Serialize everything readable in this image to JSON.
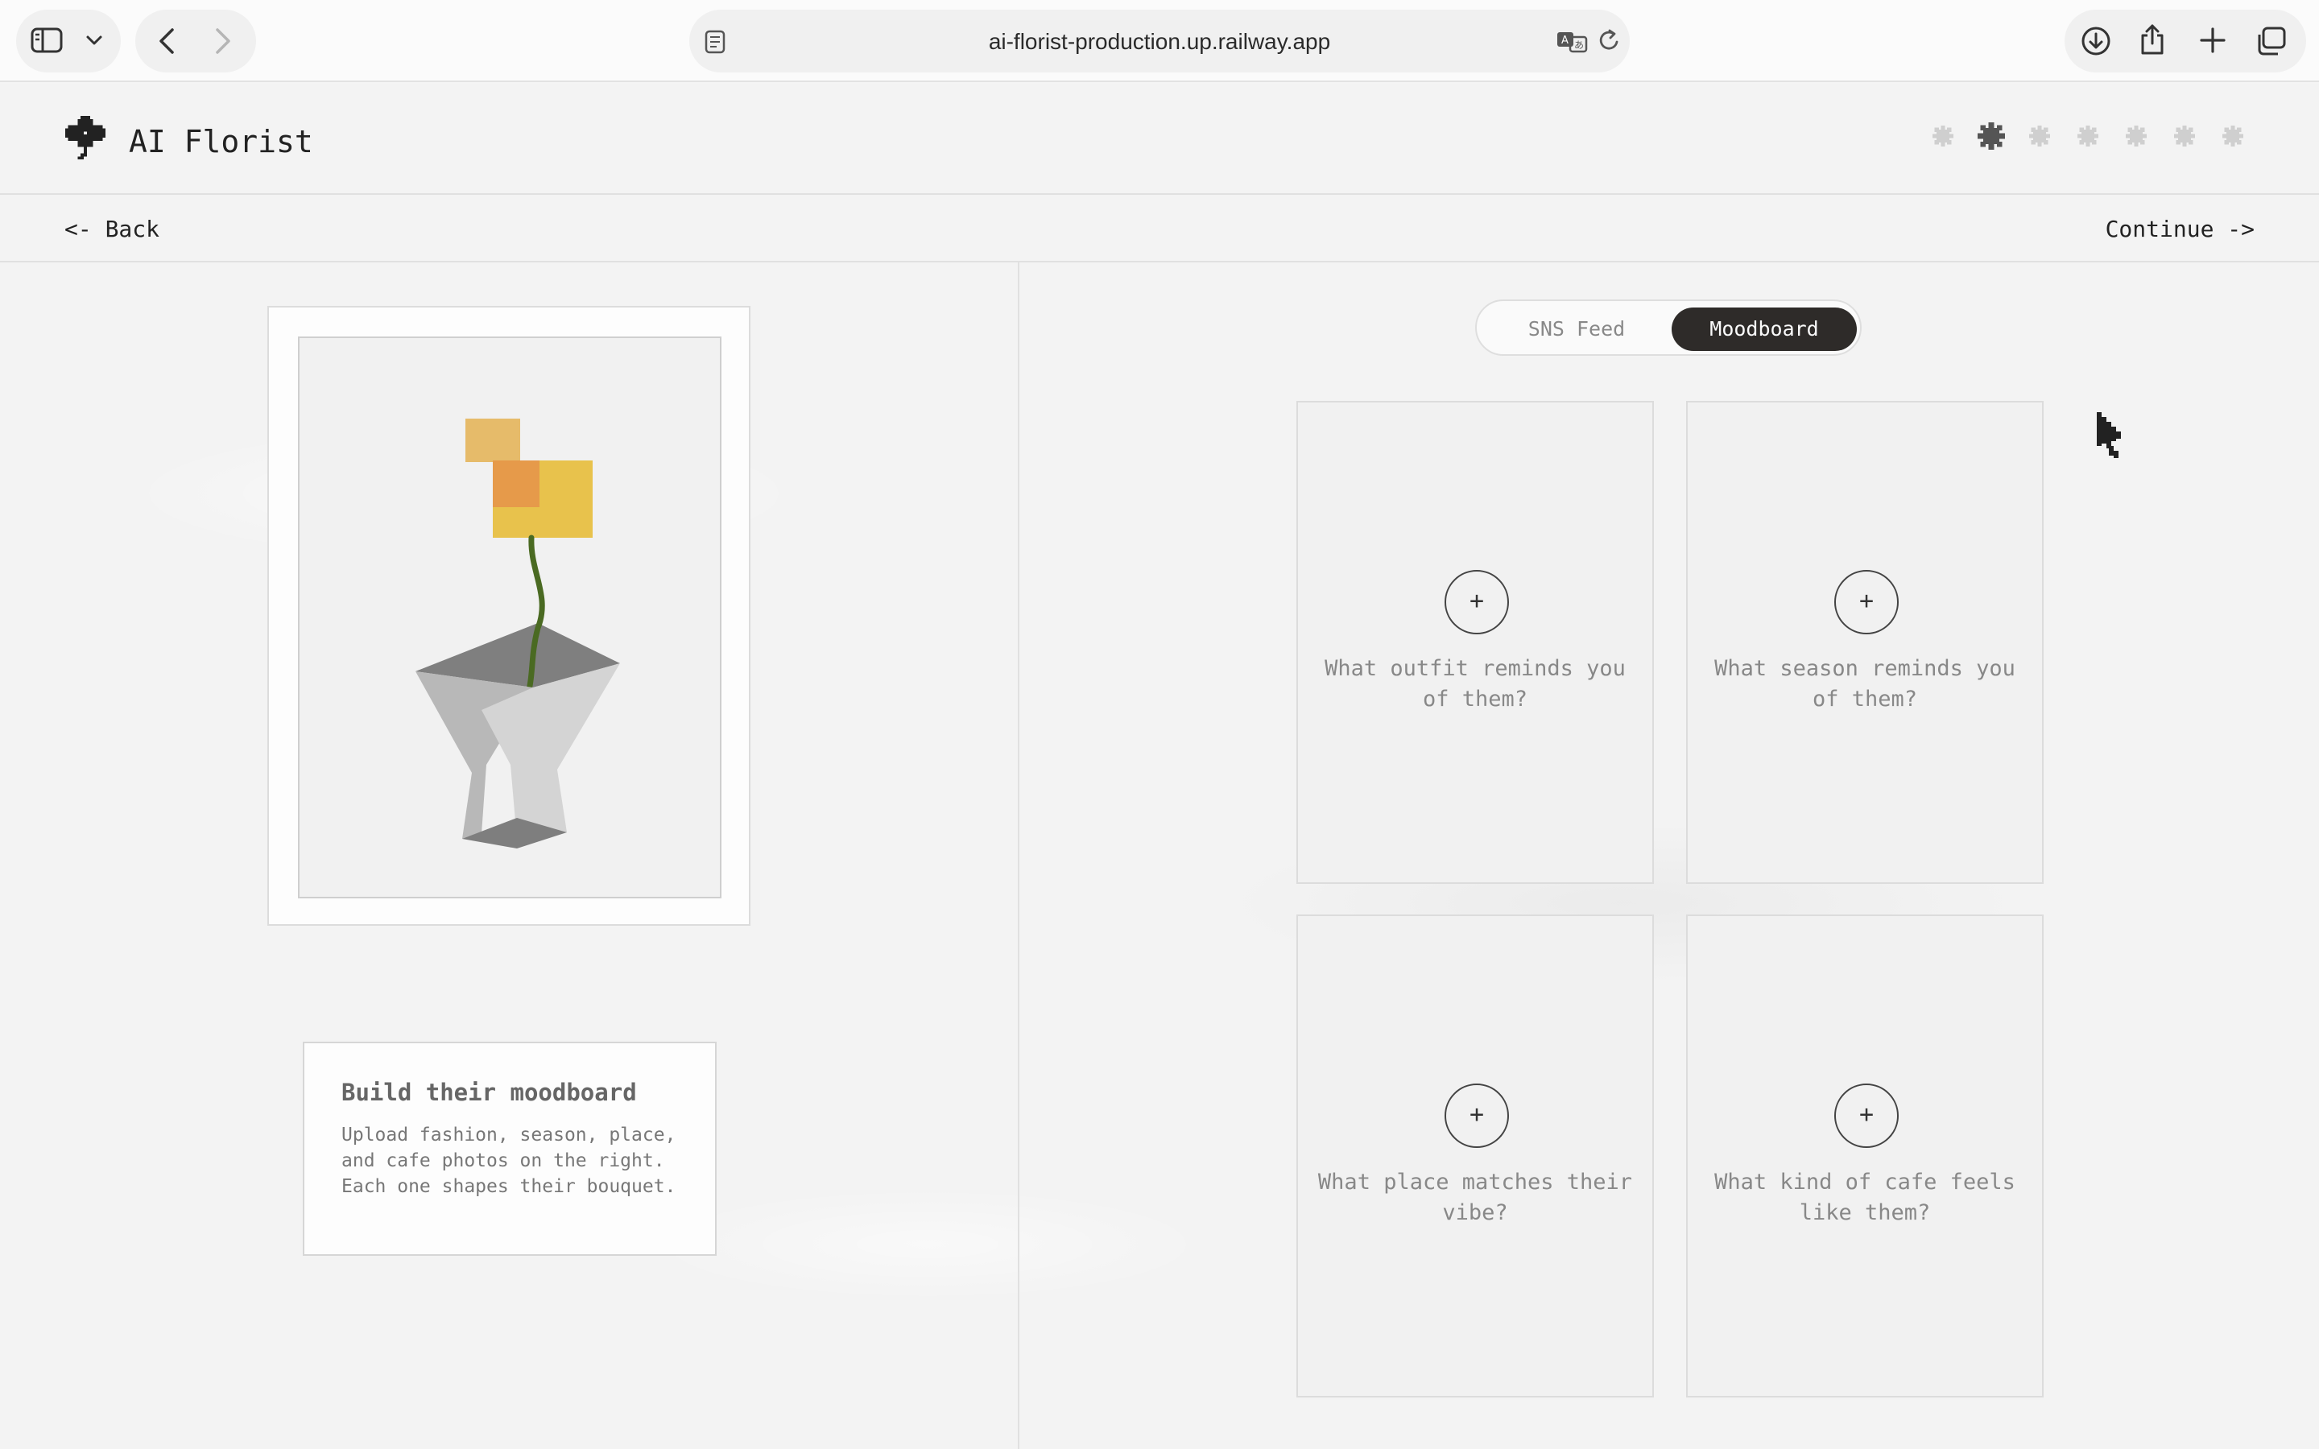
{
  "browser": {
    "url": "ai-florist-production.up.railway.app"
  },
  "app": {
    "title": "AI Florist",
    "progress": {
      "total_steps": 7,
      "current_step": 2
    }
  },
  "nav": {
    "back_label": "<- Back",
    "continue_label": "Continue ->"
  },
  "info": {
    "title": "Build their moodboard",
    "body": "Upload fashion, season, place, and cafe photos on the right. Each one shapes their bouquet."
  },
  "toggle": {
    "options": [
      "SNS Feed",
      "Moodboard"
    ],
    "selected": "Moodboard"
  },
  "tiles": [
    {
      "plus": "+",
      "prompt": "What outfit reminds you of them?"
    },
    {
      "plus": "+",
      "prompt": "What season reminds you of them?"
    },
    {
      "plus": "+",
      "prompt": "What place matches their vibe?"
    },
    {
      "plus": "+",
      "prompt": "What kind of cafe feels like them?"
    }
  ],
  "colors": {
    "accent_dark": "#2e2b29",
    "flower_yellow": "#e8c24c",
    "flower_orange": "#e69a4a",
    "flower_tan": "#e6bb6a",
    "stem_green": "#4a6a22",
    "vase_gray": "#9a9a9a"
  },
  "icons": [
    "sidebar-icon",
    "chevron-down-icon",
    "back-arrow-icon",
    "forward-arrow-icon",
    "reader-icon",
    "translate-icon",
    "reload-icon",
    "download-icon",
    "share-icon",
    "new-tab-icon",
    "tabs-overview-icon",
    "flower-logo-icon",
    "progress-flower-icon"
  ]
}
